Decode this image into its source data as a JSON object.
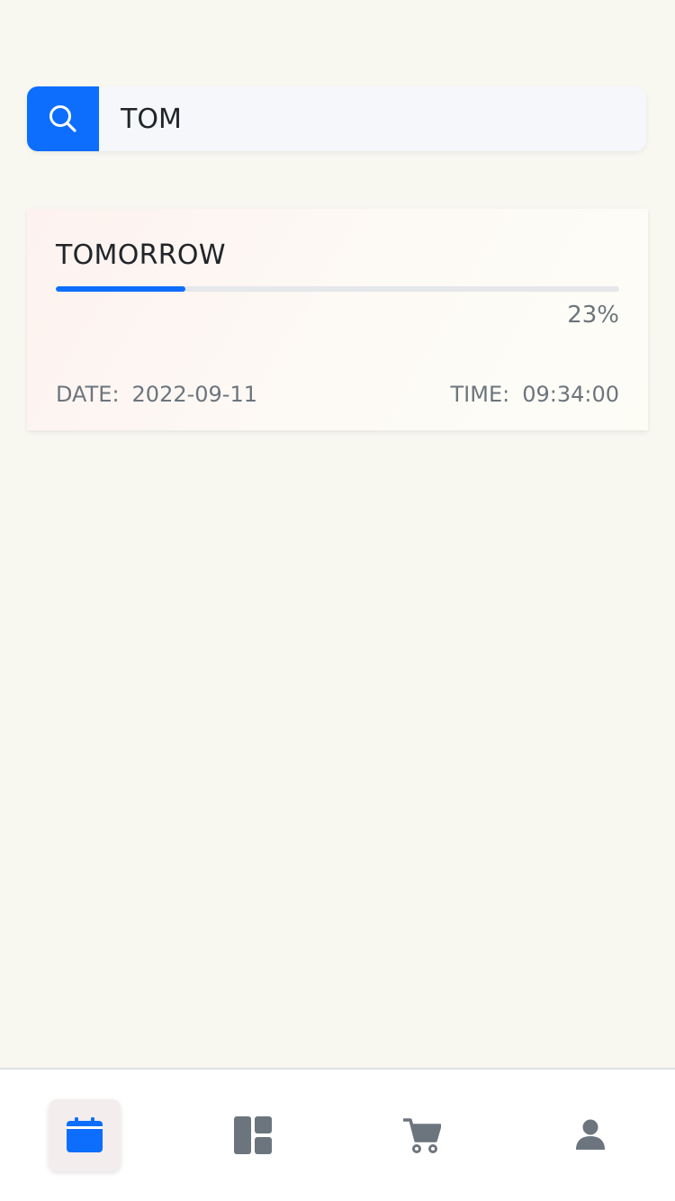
{
  "search": {
    "value": "TOM",
    "icon": "search-icon",
    "accent": "#0d6efd"
  },
  "tasks": [
    {
      "title": "TOMORROW",
      "progress": 23,
      "progress_label": "23%",
      "date_label": "DATE:",
      "date_value": "2022-09-11",
      "time_label": "TIME:",
      "time_value": "09:34:00"
    }
  ],
  "nav": {
    "items": [
      {
        "icon": "calendar-icon",
        "active": true
      },
      {
        "icon": "dashboard-layout-icon",
        "active": false
      },
      {
        "icon": "cart-icon",
        "active": false
      },
      {
        "icon": "user-icon",
        "active": false
      }
    ],
    "active_color": "#0d6efd",
    "inactive_color": "#6c757d"
  }
}
